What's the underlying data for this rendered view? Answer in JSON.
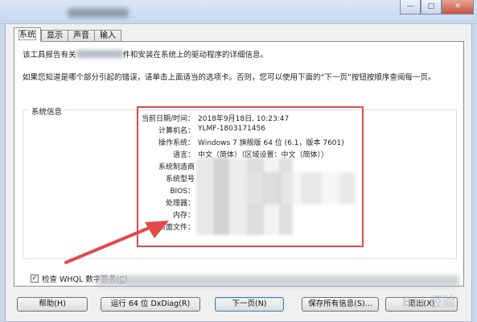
{
  "window": {
    "controls": {
      "minimize": "—",
      "maximize": "□",
      "close": "✕"
    }
  },
  "tabs": [
    {
      "label": "系统"
    },
    {
      "label": "显示"
    },
    {
      "label": "声音"
    },
    {
      "label": "输入"
    }
  ],
  "intro": {
    "line1_a": "该工具报告有关",
    "line1_b": "件和安装在系统上的驱动程序的详细信息。",
    "line2": "如果您知道是哪个部分引起的错误，请单击上面适当的选项卡。否则，您可以使用下面的“下一页”按钮按顺序查阅每一页。"
  },
  "system_info": {
    "group_label": "系统信息",
    "rows": [
      {
        "label": "当前日期/时间：",
        "value": "2018年9月18日, 10:23:47"
      },
      {
        "label": "计算机名：",
        "value": "YLMF-1803171456"
      },
      {
        "label": "操作系统：",
        "value": "Windows 7 旗舰版 64 位 (6.1，版本 7601)"
      },
      {
        "label": "语言：",
        "value": "中文（简体）（区域设置：中文（简体））"
      },
      {
        "label": "系统制造商",
        "value": ""
      },
      {
        "label": "系统型号",
        "value": ""
      },
      {
        "label": "BIOS：",
        "value": ""
      },
      {
        "label": "处理器：",
        "value": ""
      },
      {
        "label": "内存：",
        "value": ""
      },
      {
        "label": "页面文件：",
        "value": ""
      }
    ]
  },
  "checkbox": {
    "label": "检查 WHQL 数字签名(",
    "hotkey": "C",
    "suffix": ")",
    "mark": "✓"
  },
  "buttons": {
    "help": "帮助(H)",
    "run64": "运行 64 位 DxDiag(R)",
    "next": "下一页(N)",
    "save": "保存所有信息(S)...",
    "exit": "退出(X)"
  },
  "watermark": "Bai 经验",
  "colors": {
    "highlight": "#e04a4a",
    "arrow": "#e04a4a"
  }
}
